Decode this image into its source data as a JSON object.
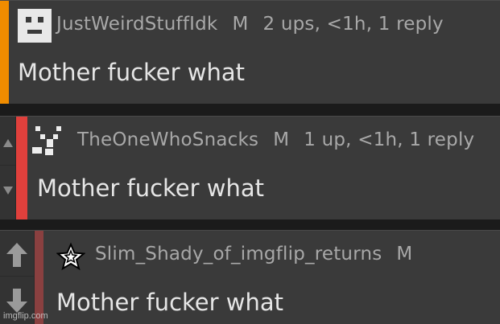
{
  "comments": [
    {
      "username": "JustWeirdStuffIdk",
      "gender": "M",
      "meta": "2 ups, <1h, 1 reply",
      "text": "Mother fucker what",
      "bar_color": "#f08c00",
      "avatar_icon": "square-face-icon"
    },
    {
      "username": "TheOneWhoSnacks",
      "gender": "M",
      "meta": "1 up, <1h, 1 reply",
      "text": "Mother fucker what",
      "bar_color": "#e0403c",
      "avatar_icon": "pixel-face-icon"
    },
    {
      "username": "Slim_Shady_of_imgflip_returns",
      "gender": "M",
      "meta": "",
      "text": "Mother fucker what",
      "bar_color": "#8a4040",
      "avatar_icon": "star-icon"
    }
  ],
  "watermark": "imgflip.com"
}
